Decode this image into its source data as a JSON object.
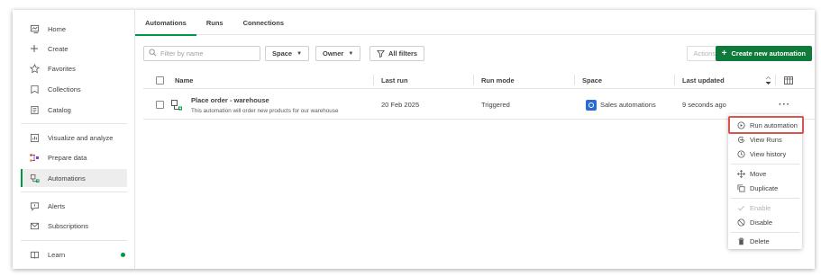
{
  "sidebar": {
    "items": [
      {
        "label": "Home",
        "icon": "home-icon"
      },
      {
        "label": "Create",
        "icon": "plus-icon"
      },
      {
        "label": "Favorites",
        "icon": "star-icon"
      },
      {
        "label": "Collections",
        "icon": "bookmark-icon"
      },
      {
        "label": "Catalog",
        "icon": "catalog-icon"
      },
      {
        "label": "Visualize and analyze",
        "icon": "chart-icon"
      },
      {
        "label": "Prepare data",
        "icon": "data-flow-icon"
      },
      {
        "label": "Automations",
        "icon": "automation-icon",
        "active": true
      },
      {
        "label": "Alerts",
        "icon": "alert-icon"
      },
      {
        "label": "Subscriptions",
        "icon": "mail-icon"
      },
      {
        "label": "Learn",
        "icon": "book-icon"
      }
    ]
  },
  "tabs": [
    {
      "label": "Automations",
      "active": true
    },
    {
      "label": "Runs"
    },
    {
      "label": "Connections"
    }
  ],
  "toolbar": {
    "search_placeholder": "Filter by name",
    "space_label": "Space",
    "owner_label": "Owner",
    "all_filters_label": "All filters",
    "actions_label": "Actions",
    "create_label": "Create new automation"
  },
  "table": {
    "headers": {
      "name": "Name",
      "last_run": "Last run",
      "run_mode": "Run mode",
      "space": "Space",
      "last_updated": "Last updated"
    },
    "rows": [
      {
        "name": "Place order - warehouse",
        "description": "This automation will order new products for our warehouse",
        "last_run": "20 Feb 2025",
        "run_mode": "Triggered",
        "space": "Sales automations",
        "last_updated": "9 seconds ago"
      }
    ]
  },
  "context_menu": {
    "items": [
      {
        "label": "Run automation",
        "icon": "play-circle-icon",
        "highlighted": true
      },
      {
        "label": "View Runs",
        "icon": "view-runs-icon"
      },
      {
        "label": "View history",
        "icon": "history-icon"
      },
      {
        "label": "Move",
        "icon": "move-icon"
      },
      {
        "label": "Duplicate",
        "icon": "duplicate-icon"
      },
      {
        "label": "Enable",
        "icon": "check-icon",
        "disabled": true
      },
      {
        "label": "Disable",
        "icon": "disable-icon"
      },
      {
        "label": "Delete",
        "icon": "trash-icon"
      }
    ]
  },
  "colors": {
    "accent": "#009845",
    "create_button": "#0f7b3a",
    "highlight_border": "#d9534f",
    "space_badge": "#2a6bd1"
  }
}
